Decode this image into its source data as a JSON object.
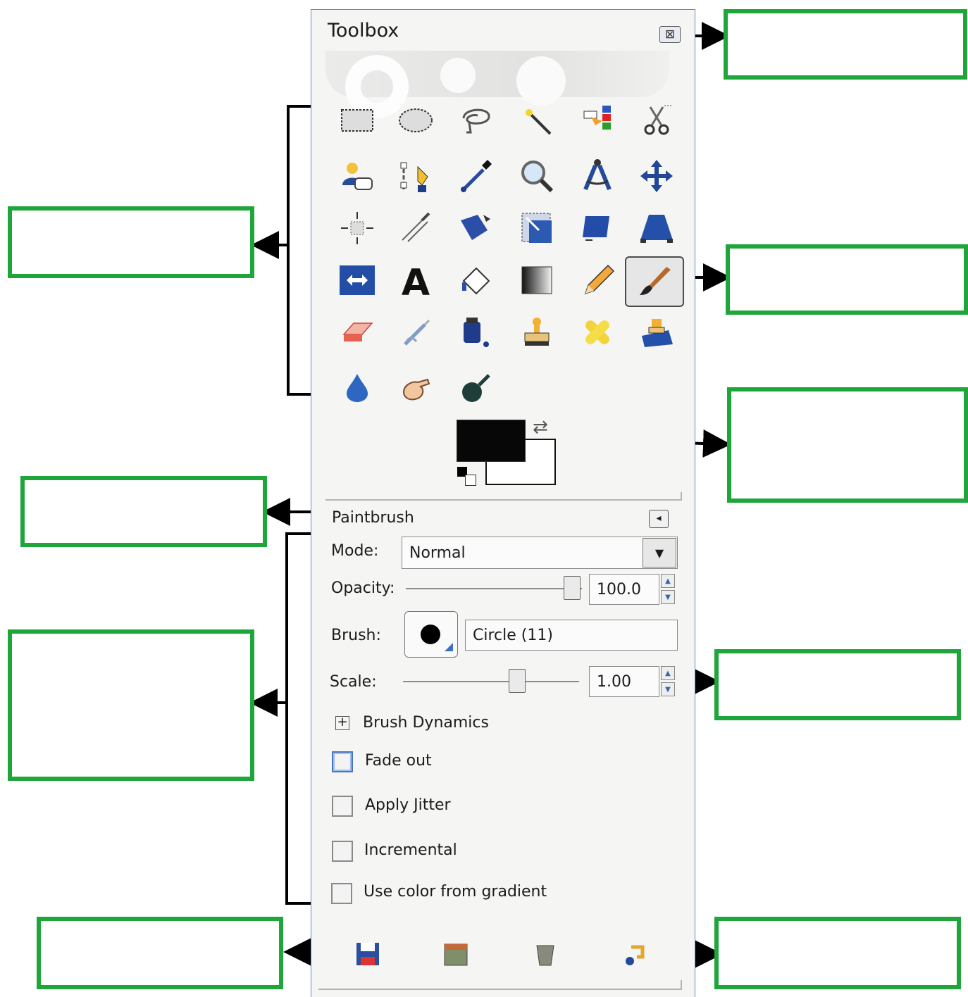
{
  "toolbox": {
    "title": "Toolbox",
    "close_icon": "close-icon"
  },
  "tools": [
    {
      "name": "rect-select-tool",
      "icon": "rect-select-icon"
    },
    {
      "name": "ellipse-select-tool",
      "icon": "ellipse-select-icon"
    },
    {
      "name": "free-select-tool",
      "icon": "lasso-icon"
    },
    {
      "name": "fuzzy-select-tool",
      "icon": "magic-wand-icon"
    },
    {
      "name": "select-by-color-tool",
      "icon": "select-by-color-icon"
    },
    {
      "name": "scissors-select-tool",
      "icon": "scissors-icon"
    },
    {
      "name": "foreground-select-tool",
      "icon": "foreground-select-icon"
    },
    {
      "name": "paths-tool",
      "icon": "paths-icon"
    },
    {
      "name": "color-picker-tool",
      "icon": "eyedropper-icon"
    },
    {
      "name": "zoom-tool",
      "icon": "magnifier-icon"
    },
    {
      "name": "measure-tool",
      "icon": "compass-icon"
    },
    {
      "name": "move-tool",
      "icon": "move-arrows-icon"
    },
    {
      "name": "align-tool",
      "icon": "align-icon"
    },
    {
      "name": "crop-tool",
      "icon": "crop-knife-icon"
    },
    {
      "name": "rotate-tool",
      "icon": "rotate-icon"
    },
    {
      "name": "scale-tool",
      "icon": "scale-icon"
    },
    {
      "name": "shear-tool",
      "icon": "shear-icon"
    },
    {
      "name": "perspective-tool",
      "icon": "perspective-icon"
    },
    {
      "name": "flip-tool",
      "icon": "flip-icon"
    },
    {
      "name": "text-tool",
      "icon": "text-icon"
    },
    {
      "name": "bucket-fill-tool",
      "icon": "bucket-icon"
    },
    {
      "name": "blend-tool",
      "icon": "gradient-icon"
    },
    {
      "name": "pencil-tool",
      "icon": "pencil-icon"
    },
    {
      "name": "paintbrush-tool",
      "icon": "paintbrush-icon",
      "active": true
    },
    {
      "name": "eraser-tool",
      "icon": "eraser-icon"
    },
    {
      "name": "airbrush-tool",
      "icon": "airbrush-icon"
    },
    {
      "name": "ink-tool",
      "icon": "ink-icon"
    },
    {
      "name": "clone-tool",
      "icon": "stamp-icon"
    },
    {
      "name": "heal-tool",
      "icon": "bandage-icon"
    },
    {
      "name": "perspective-clone-tool",
      "icon": "perspective-clone-icon"
    },
    {
      "name": "blur-sharpen-tool",
      "icon": "water-drop-icon"
    },
    {
      "name": "smudge-tool",
      "icon": "finger-icon"
    },
    {
      "name": "dodge-burn-tool",
      "icon": "dodge-burn-icon"
    }
  ],
  "colors": {
    "foreground": "#070707",
    "background": "#ffffff",
    "swap_icon": "swap-arrows-icon",
    "reset_icon": "default-colors-icon"
  },
  "options": {
    "tool_name": "Paintbrush",
    "mode_label": "Mode:",
    "mode_value": "Normal",
    "opacity_label": "Opacity:",
    "opacity_value": "100.0",
    "opacity_fraction": 1.0,
    "brush_label": "Brush:",
    "brush_value": "Circle (11)",
    "scale_label": "Scale:",
    "scale_value": "1.00",
    "dynamics_label": "Brush Dynamics",
    "checkboxes": [
      {
        "label": "Fade out",
        "checked": false
      },
      {
        "label": "Apply Jitter",
        "checked": false
      },
      {
        "label": "Incremental",
        "checked": false
      },
      {
        "label": "Use color from gradient",
        "checked": false
      }
    ]
  },
  "bottom_buttons": [
    {
      "name": "save-options-button",
      "icon": "floppy-disk-icon"
    },
    {
      "name": "restore-options-button",
      "icon": "restore-icon"
    },
    {
      "name": "delete-options-button",
      "icon": "trash-icon"
    },
    {
      "name": "reset-options-button",
      "icon": "reset-icon"
    }
  ],
  "accent": {
    "label_box_border": "#1ea63b",
    "window_border": "#6a86c8"
  }
}
